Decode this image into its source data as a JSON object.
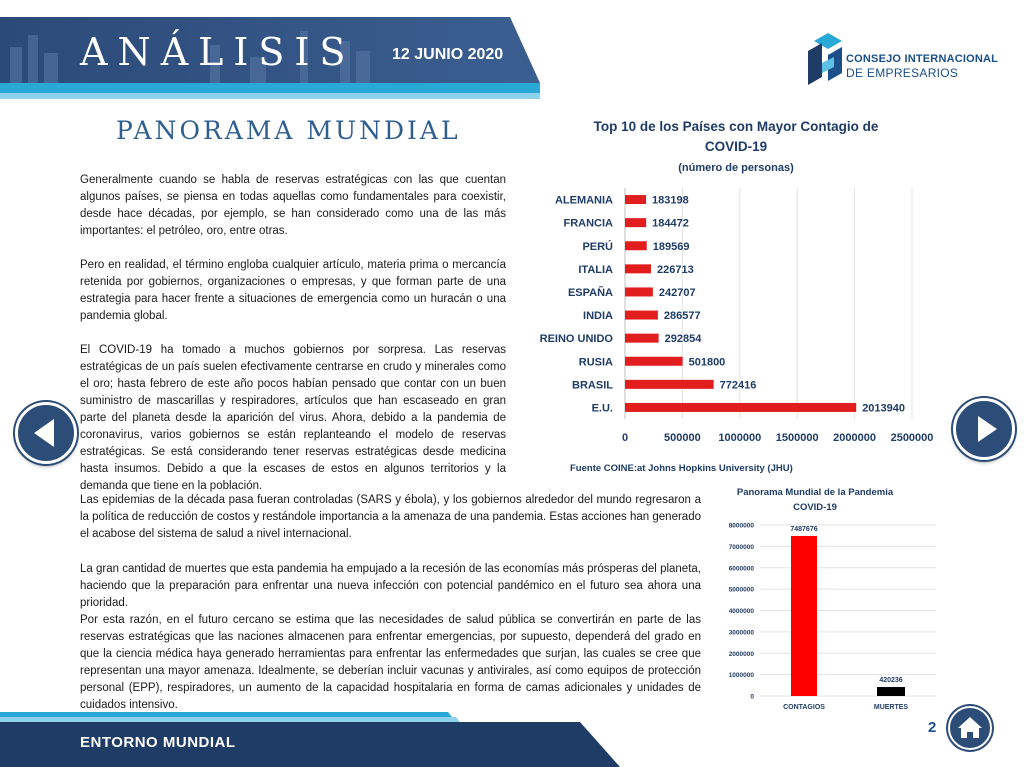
{
  "header": {
    "title": "ANÁLISIS",
    "date": "12 JUNIO 2020"
  },
  "logo": {
    "line1": "CONSEJO INTERNACIONAL",
    "line2_prefix": "DE",
    "line2_main": "EMPRESARIOS"
  },
  "section_title": "PANORAMA MUNDIAL",
  "paragraphs": [
    "Generalmente cuando se habla de reservas estratégicas con las que cuentan algunos países, se piensa en todas aquellas como fundamentales para coexistir, desde hace décadas, por ejemplo, se han considerado como una de las más importantes: el petróleo, oro, entre otras.",
    "Pero en realidad, el término engloba cualquier artículo, materia prima o mercancía retenida por gobiernos, organizaciones o empresas, y que forman parte de una estrategia para hacer frente a situaciones de emergencia como un huracán o una pandemia global.",
    "El COVID-19 ha tomado a muchos gobiernos por sorpresa. Las reservas estratégicas de un país suelen efectivamente centrarse en crudo y minerales como el oro; hasta febrero de este año pocos habían pensado que contar con un buen suministro de mascarillas y respiradores, artículos que han escaseado en gran parte del planeta desde la aparición del virus. Ahora, debido a la pandemia de coronavirus, varios gobiernos se están replanteando el modelo de reservas estratégicas. Se está considerando tener reservas estratégicas desde medicina hasta insumos. Debido a que la escases de estos en algunos territorios y la demanda que tiene en la población.",
    "Las epidemias de la década pasa fueran controladas (SARS y ébola), y los gobiernos alrededor del mundo regresaron a la política de reducción de costos y restándole importancia a la amenaza de una pandemia. Estas acciones han generado el acabose del sistema de salud a nivel internacional.",
    "La gran cantidad de muertes que esta pandemia ha empujado a la recesión de las economías más prósperas del planeta, haciendo que la preparación para enfrentar una nueva infección con potencial pandémico en el futuro sea ahora una prioridad.",
    "Por esta razón, en el futuro cercano se estima que las necesidades de salud pública se convertirán en parte de las reservas estratégicas que las naciones almacenen para enfrentar emergencias, por supuesto, dependerá del grado en que la ciencia médica haya generado herramientas para enfrentar las enfermedades que surjan, las cuales se cree que representan una mayor amenaza. Idealmente, se deberían incluir vacunas y antivirales, así como equipos de protección personal (EPP), respiradores, un aumento de la capacidad hospitalaria en forma de camas adicionales y unidades de cuidados intensivo."
  ],
  "chart_data": [
    {
      "type": "bar",
      "orientation": "horizontal",
      "title": "Top 10 de los Países con Mayor Contagio de COVID-19",
      "subtitle": "(número de personas)",
      "source": "Fuente COINE:at Johns Hopkins University (JHU)",
      "categories": [
        "ALEMANIA",
        "FRANCIA",
        "PERÚ",
        "ITALIA",
        "ESPAÑA",
        "INDIA",
        "REINO UNIDO",
        "RUSIA",
        "BRASIL",
        "E.U."
      ],
      "values": [
        183198,
        184472,
        189569,
        226713,
        242707,
        286577,
        292854,
        501800,
        772416,
        2013940
      ],
      "xlim": [
        0,
        2500000
      ],
      "ticks": [
        0,
        500000,
        1000000,
        1500000,
        2000000,
        2500000
      ],
      "bar_color": "#e11d1d",
      "grid": true
    },
    {
      "type": "bar",
      "title_line1": "Panorama Mundial de la Pandemia",
      "title_line2": "COVID-19",
      "categories": [
        "CONTAGIOS",
        "MUERTES"
      ],
      "values": [
        7487676,
        420236
      ],
      "colors": [
        "#ff0000",
        "#000000"
      ],
      "ylim": [
        0,
        8000000
      ],
      "ticks": [
        0,
        1000000,
        2000000,
        3000000,
        4000000,
        5000000,
        6000000,
        7000000,
        8000000
      ],
      "grid": true
    }
  ],
  "footer": {
    "section": "ENTORNO MUNDIAL",
    "page": "2"
  },
  "colors": {
    "navy": "#1f3c66",
    "cyan": "#29a9d6",
    "title_blue": "#2f5e90"
  }
}
